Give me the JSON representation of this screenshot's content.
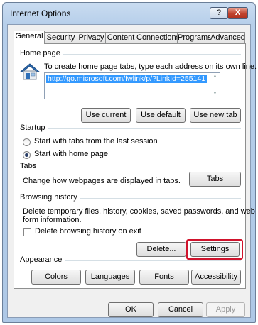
{
  "window": {
    "title": "Internet Options",
    "help_label": "?",
    "close_label": "X"
  },
  "tabs": [
    {
      "label": "General"
    },
    {
      "label": "Security"
    },
    {
      "label": "Privacy"
    },
    {
      "label": "Content"
    },
    {
      "label": "Connections"
    },
    {
      "label": "Programs"
    },
    {
      "label": "Advanced"
    }
  ],
  "home_page": {
    "group_title": "Home page",
    "description": "To create home page tabs, type each address on its own line.",
    "url_value": "http://go.microsoft.com/fwlink/p/?LinkId=255141",
    "use_current": "Use current",
    "use_default": "Use default",
    "use_new_tab": "Use new tab"
  },
  "startup": {
    "group_title": "Startup",
    "option_last_session": "Start with tabs from the last session",
    "option_home_page": "Start with home page",
    "selected": "Start with home page"
  },
  "tabs_section": {
    "group_title": "Tabs",
    "description": "Change how webpages are displayed in tabs.",
    "button": "Tabs"
  },
  "browsing_history": {
    "group_title": "Browsing history",
    "description_line1": "Delete temporary files, history, cookies, saved passwords, and web",
    "description_line2": "form information.",
    "checkbox_label": "Delete browsing history on exit",
    "checkbox_checked": false,
    "delete_button": "Delete...",
    "settings_button": "Settings",
    "highlight_color": "#d0132c"
  },
  "appearance": {
    "group_title": "Appearance",
    "colors": "Colors",
    "languages": "Languages",
    "fonts": "Fonts",
    "accessibility": "Accessibility"
  },
  "footer": {
    "ok": "OK",
    "cancel": "Cancel",
    "apply": "Apply",
    "apply_disabled": true
  }
}
